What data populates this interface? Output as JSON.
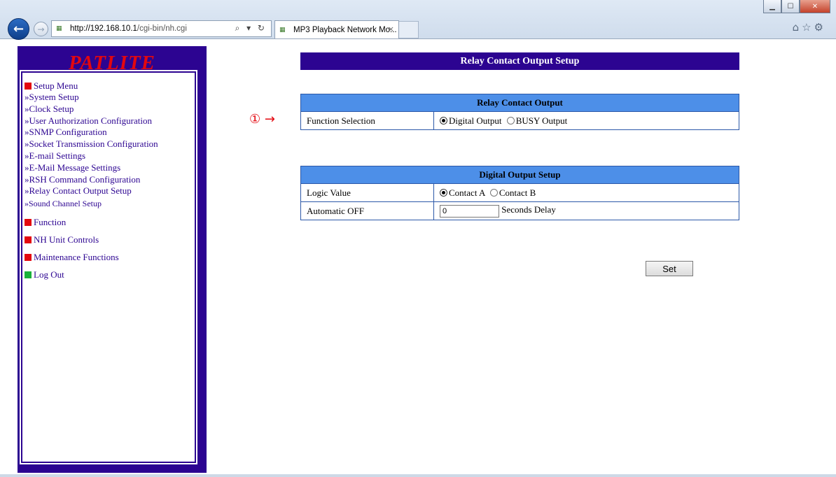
{
  "browser": {
    "url_host": "http://192.168.10.1",
    "url_path": "/cgi-bin/nh.cgi",
    "address_controls": "⌕ ▾ ↻",
    "tab_title": "MP3 Playback Network Mo...",
    "tab_close": "×",
    "window_buttons": {
      "minimize": "▁",
      "maximize": "☐",
      "close": "✕"
    },
    "toolbar_icons": "⌂☆⚙"
  },
  "sidebar": {
    "logo": "PATLITE",
    "sections": {
      "setup_menu": "Setup Menu",
      "function": "Function",
      "nh_unit_controls": "NH Unit Controls",
      "maintenance": "Maintenance Functions",
      "log_out": "Log Out"
    },
    "links": [
      "»System Setup",
      "»Clock Setup",
      "»User Authorization Configuration",
      "»SNMP Configuration",
      "»Socket Transmission Configuration",
      "»E-mail Settings",
      "»E-Mail Message Settings",
      "»RSH Command Configuration",
      "»Relay Contact Output Setup",
      "»Sound Channel Setup"
    ]
  },
  "main": {
    "annotation": "① →",
    "page_title": "Relay Contact Output Setup",
    "relay": {
      "header": "Relay Contact Output",
      "row_label": "Function Selection",
      "option_digital": "Digital Output",
      "option_busy": "BUSY Output",
      "selected": "Digital Output"
    },
    "digital": {
      "header": "Digital Output Setup",
      "logic_label": "Logic Value",
      "option_a": "Contact A",
      "option_b": "Contact B",
      "selected": "Contact A",
      "auto_off_label": "Automatic OFF",
      "auto_off_value": "0",
      "auto_off_suffix": "Seconds Delay"
    },
    "set_button": "Set"
  }
}
